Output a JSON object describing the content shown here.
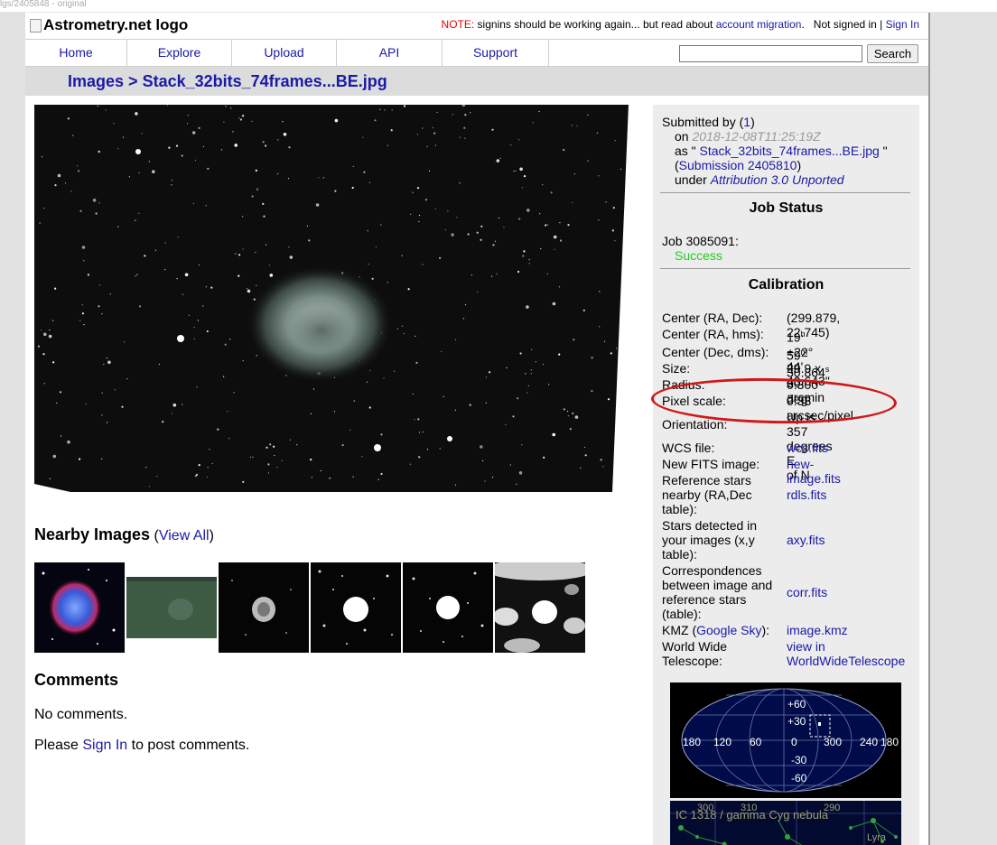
{
  "browser": {
    "strip_text": "lgs/2405848 - original"
  },
  "header": {
    "logo_alt": "Astrometry.net logo",
    "note_label": "NOTE:",
    "note_text": " signins should be working again... but read about ",
    "note_link": "account migration",
    "note_end": ".",
    "signin_status": "Not signed in |",
    "signin_link": "Sign In"
  },
  "nav": {
    "tabs": [
      "Home",
      "Explore",
      "Upload",
      "API",
      "Support"
    ],
    "search_value": "",
    "search_button": "Search"
  },
  "breadcrumb": {
    "parent": "Images",
    "sep": " > ",
    "current": "Stack_32bits_74frames...BE.jpg"
  },
  "submission": {
    "submitted_by": "Submitted by (",
    "user_link": "1",
    "close": ")",
    "on_label": "on ",
    "date": "2018-12-08T11:25:19Z",
    "as_label": "as \" ",
    "filename": "Stack_32bits_74frames...BE.jpg",
    "as_close": " \"",
    "sub_open": "(",
    "submission_link": "Submission 2405810",
    "sub_close": ")",
    "under_label": "under ",
    "license": "Attribution 3.0 Unported"
  },
  "job": {
    "heading": "Job Status",
    "label": "Job 3085091:",
    "status": "Success"
  },
  "calibration": {
    "heading": "Calibration",
    "center_radec_label": "Center (RA, Dec):",
    "center_radec": "(299.879, 22.745)",
    "center_hms_label": "Center (RA, hms):",
    "hms_h": "19",
    "hms_m": "59",
    "hms_s": "30.864",
    "center_dms_label": "Center (Dec, dms):",
    "center_dms": "+22° 44' 40.643\"",
    "size_label": "Size:",
    "size": "29.9 x 20 arcmin",
    "radius_label": "Radius:",
    "radius": "0.300 deg",
    "pixel_scale_label": "Pixel scale:",
    "pixel_scale": "0.33 arcsec/pixel",
    "orientation_label": "Orientation:",
    "orientation_1": "Up is 357 degrees E",
    "orientation_2": "of N",
    "wcs_label": "WCS file:",
    "wcs_link": "wcs.fits",
    "newfits_label": "New FITS image:",
    "newfits_link": "new-image.fits",
    "ref_label_1": "Reference stars",
    "ref_label_2": "nearby (RA,Dec",
    "ref_label_3": "table):",
    "ref_link": "rdls.fits",
    "det_label_1": "Stars detected in",
    "det_label_2": "your images (x,y",
    "det_label_3": "table):",
    "det_link": "axy.fits",
    "corr_label_1": "Correspondences",
    "corr_label_2": "between image and",
    "corr_label_3": "reference stars",
    "corr_label_4": "(table):",
    "corr_link": "corr.fits",
    "kmz_label_a": "KMZ (",
    "kmz_label_link": "Google Sky",
    "kmz_label_b": "):",
    "kmz_link": "image.kmz",
    "wwt_label_1": "World Wide",
    "wwt_label_2": "Telescope:",
    "wwt_link_1": "view in",
    "wwt_link_2": "WorldWideTelescope"
  },
  "skymap": {
    "lon_labels": [
      "180",
      "120",
      "60",
      "0",
      "300",
      "240",
      "180"
    ],
    "lat_labels": [
      "+60",
      "+30",
      "-30",
      "-60"
    ]
  },
  "zoommap": {
    "ticks": [
      "300",
      "310",
      "290"
    ],
    "object_label": "IC 1318 / gamma Cyg nebula",
    "const_label": "Lyra"
  },
  "nearby": {
    "heading": "Nearby Images",
    "view_open": " (",
    "view_all": "View All",
    "view_close": ")"
  },
  "comments": {
    "heading": "Comments",
    "none": "No comments.",
    "please": "Please ",
    "signin": "Sign In",
    "tail": " to post comments."
  },
  "colors": {
    "link": "#1a1aa8",
    "note": "#ee0000",
    "success": "#22cc22",
    "annotation_oval": "#d01818",
    "panel_bg": "#ececec"
  }
}
